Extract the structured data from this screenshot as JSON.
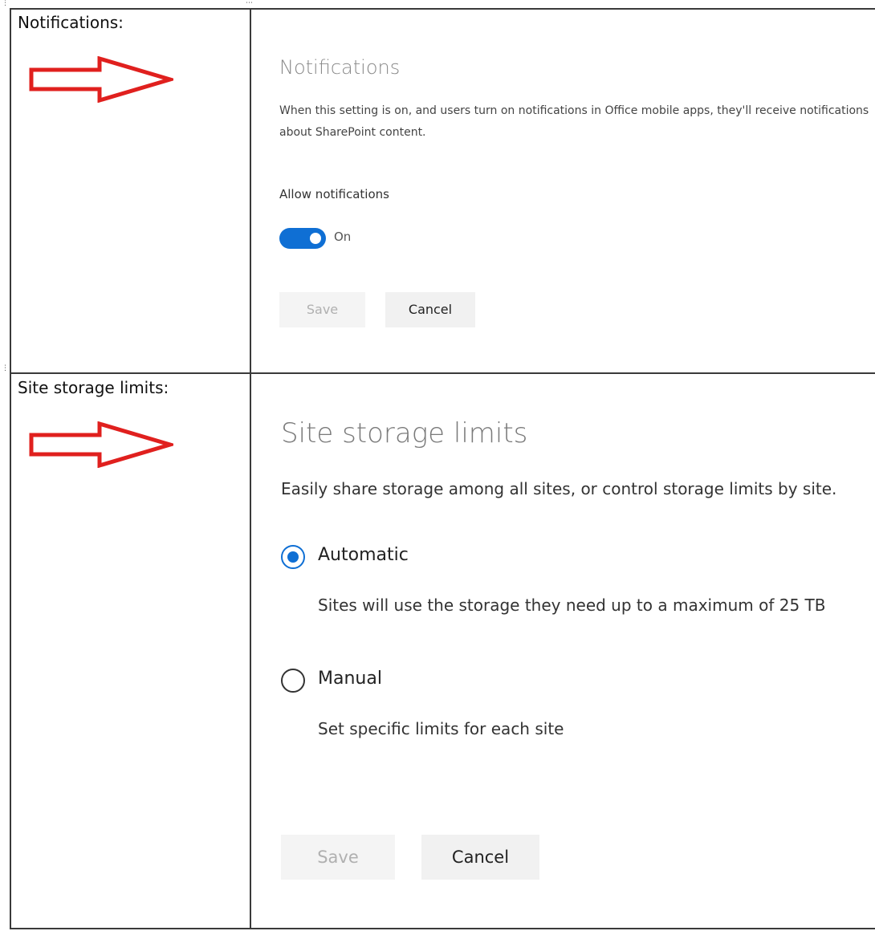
{
  "rows": [
    {
      "question_label": "Notifications:",
      "panel": {
        "title": "Notifications",
        "description": "When this setting is on, and users turn on notifications in Office mobile apps, they'll receive notifications about SharePoint content.",
        "toggle_heading": "Allow notifications",
        "toggle_state": "On",
        "toggle_on": true,
        "save_label": "Save",
        "cancel_label": "Cancel"
      }
    },
    {
      "question_label": "Site storage limits:",
      "panel": {
        "title": "Site storage limits",
        "description": "Easily share storage among all sites, or control storage limits by site.",
        "options": [
          {
            "label": "Automatic",
            "description": "Sites will use the storage they need up to a maximum of 25 TB",
            "selected": true
          },
          {
            "label": "Manual",
            "description": "Set specific limits for each site",
            "selected": false
          }
        ],
        "save_label": "Save",
        "cancel_label": "Cancel"
      }
    }
  ],
  "colors": {
    "accent": "#0f6fd4",
    "arrow": "#e0201e",
    "grid_lines": "#3a3a3a"
  },
  "icons": {
    "row_marker": "red-outline-right-arrow-icon"
  }
}
